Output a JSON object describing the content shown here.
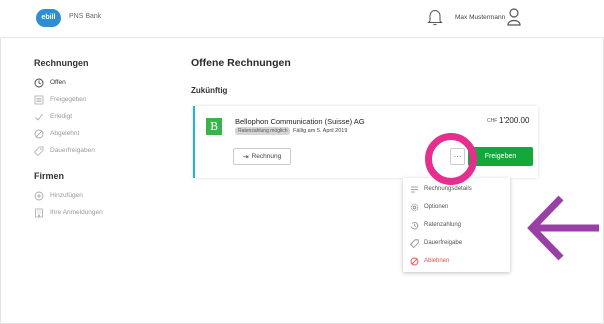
{
  "header": {
    "logo_text": "ebill",
    "bank_name": "PNS Bank",
    "user_name": "Max Mustermann"
  },
  "sidebar": {
    "rechnungen_heading": "Rechnungen",
    "rechnungen_items": [
      {
        "label": "Offen",
        "icon": "clock-icon",
        "active": true
      },
      {
        "label": "Freigegeben",
        "icon": "list-icon",
        "active": false
      },
      {
        "label": "Erledigt",
        "icon": "check-icon",
        "active": false
      },
      {
        "label": "Abgelehnt",
        "icon": "block-icon",
        "active": false
      },
      {
        "label": "Dauerfreigaben",
        "icon": "tag-icon",
        "active": false
      }
    ],
    "firmen_heading": "Firmen",
    "firmen_items": [
      {
        "label": "Hinzufügen",
        "icon": "plus-circle-icon"
      },
      {
        "label": "Ihre Anmeldungen",
        "icon": "building-icon"
      }
    ]
  },
  "main": {
    "title": "Offene Rechnungen",
    "section": "Zukünftig",
    "invoice": {
      "logo_letter": "B",
      "company": "Bellophon Communication (Suisse) AG",
      "tag": "Ratenzahlung möglich",
      "due": "Fällig am 5. April 2019",
      "currency": "CHF",
      "amount": "1'200.00",
      "rechnung_button": "Rechnung",
      "more_button": "···",
      "freigeben_button": "Freigeben"
    }
  },
  "dropdown": {
    "items": [
      {
        "label": "Rechnungsdetails",
        "icon": "details-icon"
      },
      {
        "label": "Optionen",
        "icon": "gear-icon"
      },
      {
        "label": "Ratenzahlung",
        "icon": "history-icon"
      },
      {
        "label": "Dauerfreigabe",
        "icon": "tag-icon"
      },
      {
        "label": "Ablehnen",
        "icon": "block-icon",
        "danger": true
      }
    ]
  },
  "colors": {
    "accent": "#2f8dd2",
    "primary_button": "#14a83a",
    "annotation_circle": "#e62e8f",
    "annotation_arrow": "#9b3fa8",
    "card_border": "#29b1d7",
    "danger": "#d9534f"
  }
}
